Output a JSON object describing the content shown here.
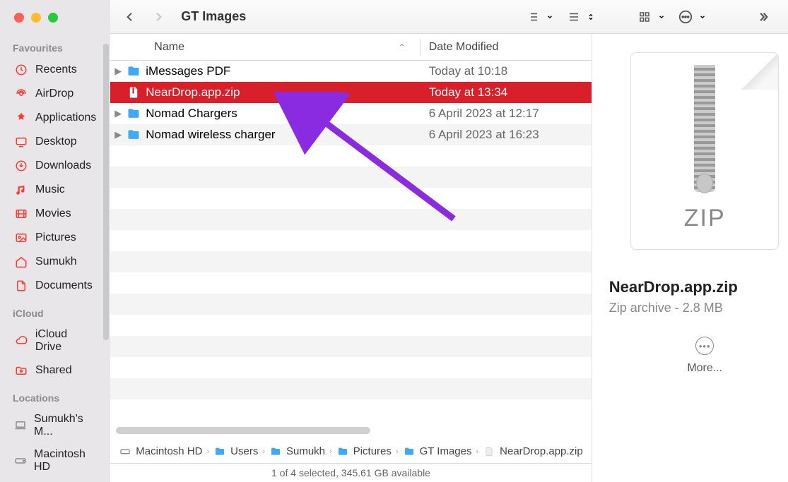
{
  "window": {
    "title": "GT Images"
  },
  "sidebar": {
    "sections": [
      {
        "heading": "Favourites",
        "items": [
          {
            "icon": "clock-icon",
            "label": "Recents"
          },
          {
            "icon": "airdrop-icon",
            "label": "AirDrop"
          },
          {
            "icon": "apps-icon",
            "label": "Applications"
          },
          {
            "icon": "desktop-icon",
            "label": "Desktop"
          },
          {
            "icon": "download-icon",
            "label": "Downloads"
          },
          {
            "icon": "music-icon",
            "label": "Music"
          },
          {
            "icon": "movies-icon",
            "label": "Movies"
          },
          {
            "icon": "pictures-icon",
            "label": "Pictures"
          },
          {
            "icon": "home-icon",
            "label": "Sumukh"
          },
          {
            "icon": "documents-icon",
            "label": "Documents"
          }
        ]
      },
      {
        "heading": "iCloud",
        "items": [
          {
            "icon": "cloud-icon",
            "label": "iCloud Drive"
          },
          {
            "icon": "shared-icon",
            "label": "Shared"
          }
        ]
      },
      {
        "heading": "Locations",
        "items": [
          {
            "icon": "laptop-icon",
            "label": "Sumukh's M...",
            "gray": true
          },
          {
            "icon": "disk-icon",
            "label": "Macintosh HD",
            "gray": true
          }
        ]
      }
    ]
  },
  "columns": {
    "name": "Name",
    "date": "Date Modified"
  },
  "files": [
    {
      "kind": "folder",
      "name": "iMessages PDF",
      "date": "Today at 10:18",
      "hasChildren": true,
      "selected": false
    },
    {
      "kind": "zip",
      "name": "NearDrop.app.zip",
      "date": "Today at 13:34",
      "hasChildren": false,
      "selected": true
    },
    {
      "kind": "folder",
      "name": "Nomad Chargers",
      "date": "6 April 2023 at 12:17",
      "hasChildren": true,
      "selected": false
    },
    {
      "kind": "folder",
      "name": "Nomad wireless charger",
      "date": "6 April 2023 at 16:23",
      "hasChildren": true,
      "selected": false
    }
  ],
  "preview": {
    "badge": "ZIP",
    "title": "NearDrop.app.zip",
    "subtitle": "Zip archive - 2.8 MB",
    "more_label": "More..."
  },
  "pathbar": {
    "segments": [
      {
        "icon": "disk-mini-icon",
        "label": "Macintosh HD"
      },
      {
        "icon": "folder-mini-icon",
        "label": "Users"
      },
      {
        "icon": "folder-mini-icon",
        "label": "Sumukh"
      },
      {
        "icon": "folder-mini-icon",
        "label": "Pictures"
      },
      {
        "icon": "folder-mini-icon",
        "label": "GT Images"
      },
      {
        "icon": "zip-mini-icon",
        "label": "NearDrop.app.zip"
      }
    ]
  },
  "status": "1 of 4 selected, 345.61 GB available"
}
